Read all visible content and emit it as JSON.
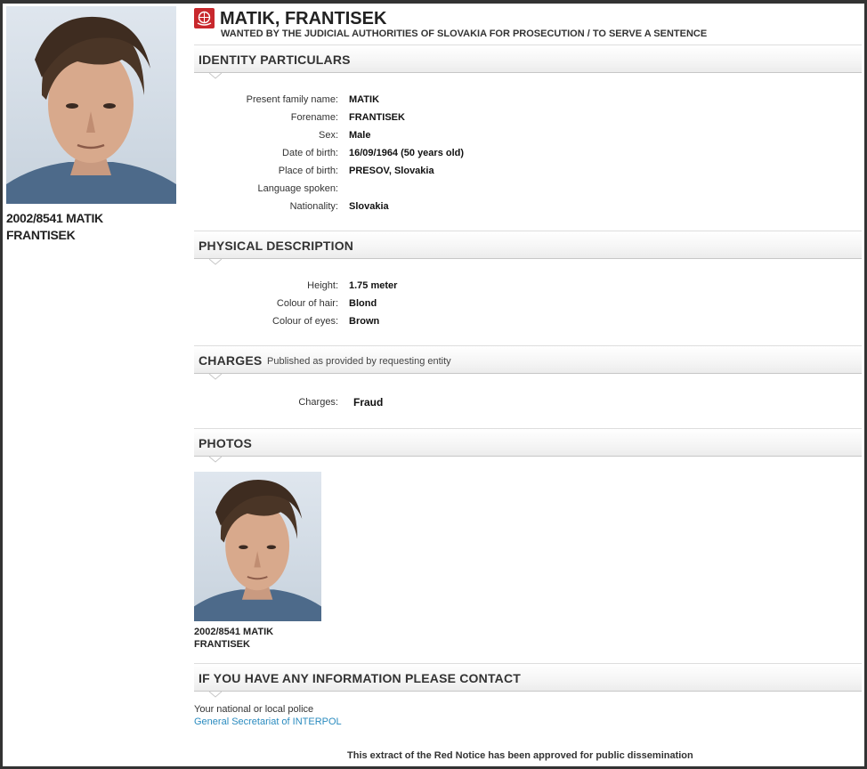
{
  "header": {
    "name": "MATIK, FRANTISEK",
    "subtitle": "WANTED BY THE JUDICIAL AUTHORITIES OF SLOVAKIA FOR PROSECUTION / TO SERVE A SENTENCE"
  },
  "main_photo": {
    "caption_line1": "2002/8541 MATIK",
    "caption_line2": "FRANTISEK"
  },
  "identity": {
    "heading": "IDENTITY PARTICULARS",
    "rows": [
      {
        "label": "Present family name:",
        "value": "MATIK"
      },
      {
        "label": "Forename:",
        "value": "FRANTISEK"
      },
      {
        "label": "Sex:",
        "value": "Male"
      },
      {
        "label": "Date of birth:",
        "value": "16/09/1964 (50 years old)"
      },
      {
        "label": "Place of birth:",
        "value": "PRESOV, Slovakia"
      },
      {
        "label": "Language spoken:",
        "value": ""
      },
      {
        "label": "Nationality:",
        "value": "Slovakia"
      }
    ]
  },
  "physical": {
    "heading": "PHYSICAL DESCRIPTION",
    "rows": [
      {
        "label": "Height:",
        "value": "1.75 meter"
      },
      {
        "label": "Colour of hair:",
        "value": "Blond"
      },
      {
        "label": "Colour of eyes:",
        "value": "Brown"
      }
    ]
  },
  "charges": {
    "heading": "CHARGES",
    "note": "Published as provided by requesting entity",
    "label": "Charges:",
    "value": "Fraud"
  },
  "photos": {
    "heading": "PHOTOS",
    "caption_line1": "2002/8541 MATIK",
    "caption_line2": "FRANTISEK"
  },
  "contact": {
    "heading": "IF YOU HAVE ANY INFORMATION PLEASE CONTACT",
    "line1": "Your national or local police",
    "link": "General Secretariat of INTERPOL"
  },
  "footer": {
    "text": "This extract of the Red Notice has been approved for public dissemination"
  },
  "colors": {
    "link": "#2a8bbf",
    "logo": "#c8282d"
  },
  "icons": {
    "logo": "interpol-logo-icon"
  }
}
